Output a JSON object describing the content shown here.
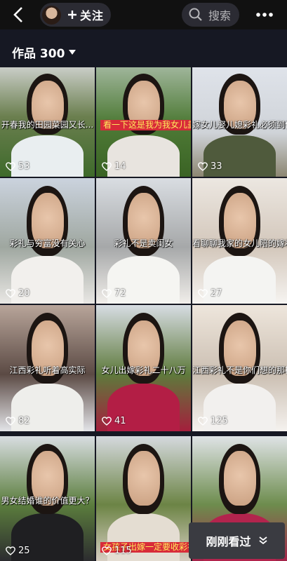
{
  "header": {
    "follow_label": "关注",
    "search_placeholder": "搜索",
    "back_icon": "chevron-left-icon",
    "more_icon": "more-dots-icon"
  },
  "section": {
    "title": "作品 300"
  },
  "recent_button": {
    "label": "刚刚看过"
  },
  "colors": {
    "background": "#161823",
    "pill": "#2b2b33",
    "accent_red": "#d82b39"
  },
  "videos": [
    {
      "caption": "开春我的田园菜园又长...",
      "caption_style": "plain",
      "likes": "53"
    },
    {
      "caption": "看一下这是我为我女儿盖",
      "caption_style": "red",
      "likes": "14"
    },
    {
      "caption": "嫁女儿娶儿媳彩礼必须到位",
      "caption_style": "plain",
      "likes": "33"
    },
    {
      "caption": "彩礼与穷富没有关心",
      "caption_style": "plain",
      "likes": "20"
    },
    {
      "caption": "彩礼不是卖闺女",
      "caption_style": "plain",
      "likes": "72"
    },
    {
      "caption": "看聊聊我家的女儿陪的嫁妆",
      "caption_style": "plain",
      "likes": "27"
    },
    {
      "caption": "江西彩礼听着高实际",
      "caption_style": "plain",
      "likes": "82"
    },
    {
      "caption": "女儿出嫁彩礼二十八万",
      "caption_style": "plain",
      "likes": "41"
    },
    {
      "caption": "江西彩礼不是你们想的那样",
      "caption_style": "plain",
      "likes": "125"
    },
    {
      "caption": "男女结婚谁的价值更大？",
      "caption_style": "plain",
      "likes": "25"
    },
    {
      "caption": "女孩子出嫁一定要收彩礼",
      "caption_style": "red",
      "likes": "115"
    },
    {
      "caption": "",
      "caption_style": "plain",
      "likes": ""
    }
  ]
}
